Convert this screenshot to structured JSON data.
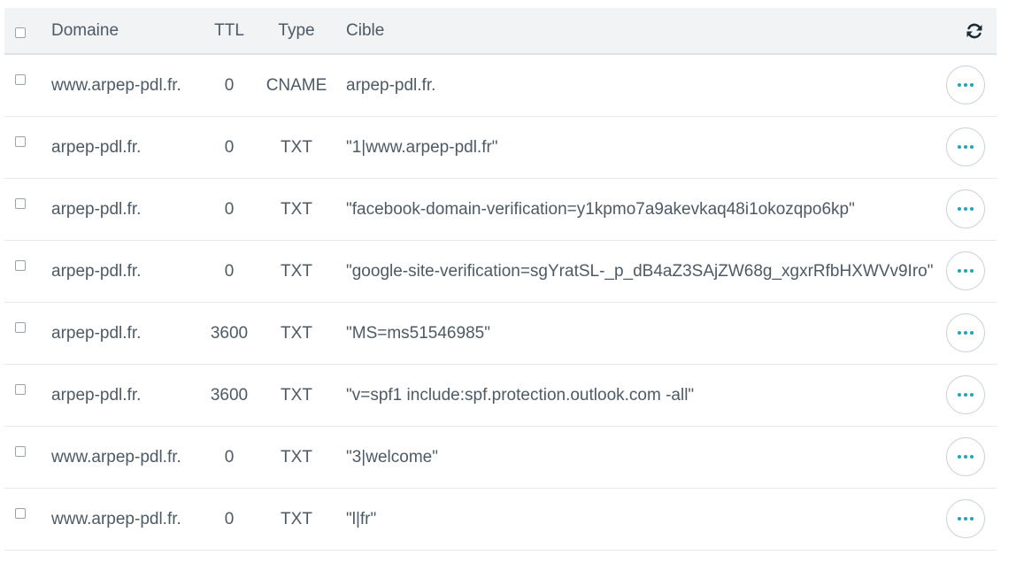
{
  "header": {
    "domain_label": "Domaine",
    "ttl_label": "TTL",
    "type_label": "Type",
    "target_label": "Cible",
    "refresh_icon": "refresh-icon"
  },
  "records": [
    {
      "domain": "www.arpep-pdl.fr.",
      "ttl": "0",
      "type": "CNAME",
      "target": "arpep-pdl.fr."
    },
    {
      "domain": "arpep-pdl.fr.",
      "ttl": "0",
      "type": "TXT",
      "target": "\"1|www.arpep-pdl.fr\""
    },
    {
      "domain": "arpep-pdl.fr.",
      "ttl": "0",
      "type": "TXT",
      "target": "\"facebook-domain-verification=y1kpmo7a9akevkaq48i1okozqpo6kp\""
    },
    {
      "domain": "arpep-pdl.fr.",
      "ttl": "0",
      "type": "TXT",
      "target": "\"google-site-verification=sgYratSL-_p_dB4aZ3SAjZW68g_xgxrRfbHXWVv9Iro\""
    },
    {
      "domain": "arpep-pdl.fr.",
      "ttl": "3600",
      "type": "TXT",
      "target": "\"MS=ms51546985\""
    },
    {
      "domain": "arpep-pdl.fr.",
      "ttl": "3600",
      "type": "TXT",
      "target": "\"v=spf1 include:spf.protection.outlook.com -all\""
    },
    {
      "domain": "www.arpep-pdl.fr.",
      "ttl": "0",
      "type": "TXT",
      "target": "\"3|welcome\""
    },
    {
      "domain": "www.arpep-pdl.fr.",
      "ttl": "0",
      "type": "TXT",
      "target": "\"l|fr\""
    }
  ],
  "colors": {
    "header_bg": "#f1f3f4",
    "accent": "#1ea7b8",
    "text": "#4d5a66"
  }
}
